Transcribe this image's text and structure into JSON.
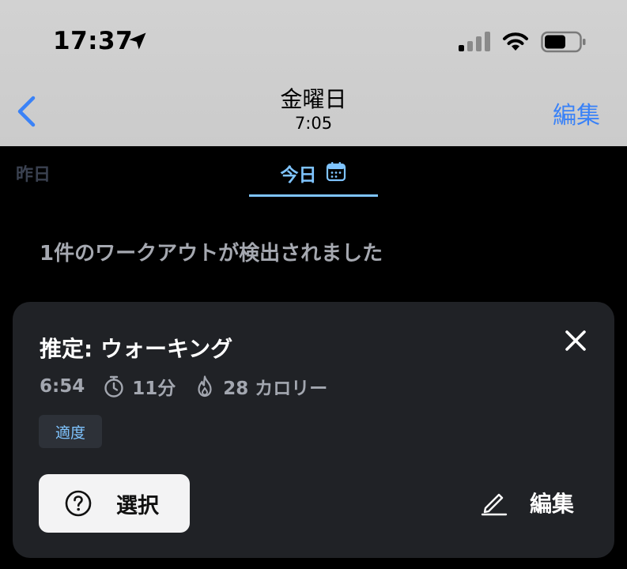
{
  "status_bar": {
    "time": "17:37",
    "icons": [
      "location-arrow-icon",
      "cellular-signal-icon",
      "wifi-icon",
      "battery-icon"
    ]
  },
  "nav": {
    "title": "金曜日",
    "subtitle": "7:05",
    "edit_label": "編集",
    "back_icon": "chevron-left-icon"
  },
  "tabs": {
    "yesterday": "昨日",
    "today": "今日",
    "today_icon": "calendar-icon"
  },
  "detected_message": "1件のワークアウトが検出されました",
  "workout_card": {
    "title": "推定: ウォーキング",
    "start_time": "6:54",
    "duration": "11分",
    "calories": "28 カロリー",
    "intensity": "適度",
    "select_label": "選択",
    "edit_label": "編集"
  },
  "colors": {
    "header_bg": "#cbcbcb",
    "accent_blue": "#3a82f7",
    "tab_active": "#7fc4ff",
    "card_bg": "#202226",
    "muted_text": "#a3a7b0"
  }
}
